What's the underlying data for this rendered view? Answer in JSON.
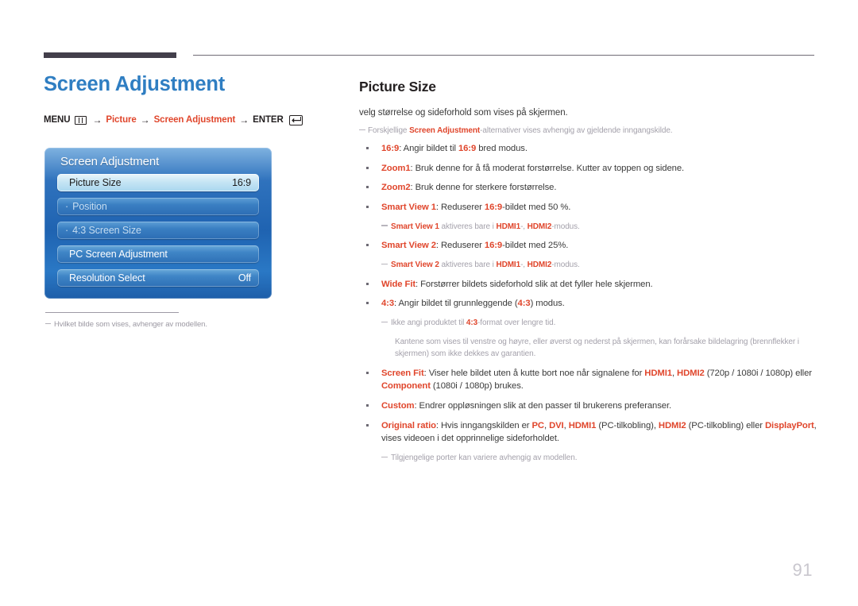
{
  "page": {
    "number": "91"
  },
  "left": {
    "title": "Screen Adjustment",
    "menu_path": {
      "menu_label": "MENU",
      "menu_icon": "menu-bars-icon",
      "arrow": "→",
      "step1": "Picture",
      "step2": "Screen Adjustment",
      "enter_label": "ENTER",
      "enter_icon": "enter-return-icon"
    },
    "osd": {
      "header": "Screen Adjustment",
      "rows": [
        {
          "label": "Picture Size",
          "value": "16:9",
          "state": "selected",
          "dot": ""
        },
        {
          "label": "Position",
          "value": "",
          "state": "sub",
          "dot": "·"
        },
        {
          "label": "4:3 Screen Size",
          "value": "",
          "state": "sub",
          "dot": "·"
        },
        {
          "label": "PC Screen Adjustment",
          "value": "",
          "state": "normal",
          "dot": ""
        },
        {
          "label": "Resolution Select",
          "value": "Off",
          "state": "normal",
          "dot": ""
        }
      ]
    },
    "footnote": "Hvilket bilde som vises, avhenger av modellen."
  },
  "right": {
    "title": "Picture Size",
    "lead": "velg størrelse og sideforhold som vises på skjermen.",
    "note_top": {
      "pre": "Forskjellige ",
      "accent": "Screen Adjustment",
      "post": "-alternativer vises avhengig av gjeldende inngangskilde."
    },
    "items": [
      {
        "term": "16:9",
        "rest_a": ": Angir bildet til ",
        "accent_mid": "16:9",
        "rest_b": " bred modus."
      },
      {
        "term": "Zoom1",
        "rest_a": ": Bruk denne for å få moderat forstørrelse. Kutter av toppen og sidene.",
        "accent_mid": "",
        "rest_b": ""
      },
      {
        "term": "Zoom2",
        "rest_a": ": Bruk denne for sterkere forstørrelse.",
        "accent_mid": "",
        "rest_b": ""
      },
      {
        "term": "Smart View 1",
        "rest_a": ": Reduserer ",
        "accent_mid": "16:9",
        "rest_b": "-bildet med 50 %."
      },
      {
        "term": "Smart View 2",
        "rest_a": ": Reduserer ",
        "accent_mid": "16:9",
        "rest_b": "-bildet med 25%."
      },
      {
        "term": "Wide Fit",
        "rest_a": ": Forstørrer bildets sideforhold slik at det fyller hele skjermen.",
        "accent_mid": "",
        "rest_b": ""
      },
      {
        "term": "4:3",
        "rest_a": ": Angir bildet til grunnleggende (",
        "accent_mid": "4:3",
        "rest_b": ") modus."
      }
    ],
    "note_sv1": {
      "accent1": "Smart View 1",
      "mid": " aktiveres bare i ",
      "accent2": "HDMI1",
      "sep": "-, ",
      "accent3": "HDMI2",
      "tail": "-modus."
    },
    "note_sv2": {
      "accent1": "Smart View 2",
      "mid": " aktiveres bare i ",
      "accent2": "HDMI1",
      "sep": "-, ",
      "accent3": "HDMI2",
      "tail": "-modus."
    },
    "note_43": {
      "pre": "Ikke angi produktet til ",
      "accent": "4:3",
      "post": "-format over lengre tid."
    },
    "note_43_body": "Kantene som vises til venstre og høyre, eller øverst og nederst på skjermen, kan forårsake bildelagring (brennflekker i skjermen) som ikke dekkes av garantien.",
    "item_screen_fit": {
      "term": "Screen Fit",
      "p1": ": Viser hele bildet uten å kutte bort noe når signalene for ",
      "a1": "HDMI1",
      "p2": ", ",
      "a2": "HDMI2",
      "p3": " (720p / 1080i / 1080p) eller ",
      "a3": "Component",
      "p4": " (1080i / 1080p) brukes."
    },
    "item_custom": {
      "term": "Custom",
      "p1": ": Endrer oppløsningen slik at den passer til brukerens preferanser."
    },
    "item_original": {
      "term": "Original ratio",
      "p1": ": Hvis inngangskilden er ",
      "a1": "PC",
      "p2": ", ",
      "a2": "DVI",
      "p3": ", ",
      "a3": "HDMI1",
      "p4": " (PC-tilkobling), ",
      "a4": "HDMI2",
      "p5": " (PC-tilkobling) eller ",
      "a5": "DisplayPort",
      "p6": ", vises videoen i det opprinnelige sideforholdet."
    },
    "note_ports": "Tilgjengelige porter kan variere avhengig av modellen."
  },
  "colors": {
    "accent": "#e0462c",
    "title_blue": "#2f7ec2",
    "osd_blue": "#2f72bd",
    "note_gray": "#a4a1ab"
  }
}
